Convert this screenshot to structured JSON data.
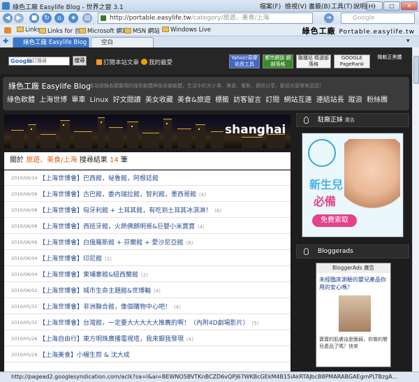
{
  "window": {
    "title": "綠色工廠 Easylife Blog - 世界之窗 3.1",
    "min": "–",
    "max": "□",
    "close": "✕"
  },
  "nav": {
    "url_host": "http://portable.easylife.tw",
    "url_path": "/category/旅遊、美食/上海",
    "search_placeholder": "Google"
  },
  "menus": [
    "檔案(F)",
    "檢視(V)",
    "書籤(B)",
    "工具(T)",
    "說明(H)"
  ],
  "bookmarks": [
    "Links",
    "Links for 台灣",
    "Microsoft 網站",
    "MSN 網站",
    "Windows Live"
  ],
  "brand": {
    "main": "綠色工廠",
    "sub": "Portable.easylife.tw"
  },
  "tabs": [
    {
      "label": "綠色工廠 Easylife Blog"
    },
    {
      "label": "空白"
    }
  ],
  "site": {
    "gsearch": "自訂搜尋",
    "gsearch_logo": "Google",
    "gbtn": "搜尋",
    "subscribe": "訂閱本站文章",
    "favorite": "我的最愛",
    "badges": [
      "Yahoo!奇摩 站長工具",
      "都市網誌 網部落格",
      "聯播站 精選部落格",
      "GOOGLE PageRank",
      "微軟正黑體"
    ],
    "title": "綠色工廠 Easylife Blog",
    "desc": "本站收錄各類實用的綠色軟體與免安裝軟體，生活中的大小事、美食、電影、資訊分享，歡迎大家常來逛逛！",
    "nav": "綠色軟體 上海世博 單車 Linux 好文閱讀 美女收藏 美食&旅遊 標籤 訪客留言 訂閱 網站互連 連結站長 蹤浪 粉絲團",
    "banner_city": "shanghai",
    "result": {
      "prefix": "關於",
      "tag1": "旅遊、美食/上海",
      "suffix": "搜尋結果",
      "count": "14",
      "unit": "筆"
    }
  },
  "posts": [
    {
      "date": "2010/06/14",
      "title": "【上海世博會】巴西館，祕魯館，阿根廷館",
      "count": ""
    },
    {
      "date": "2010/06/09",
      "title": "【上海世博會】古巴館，委內瑞拉館，智利館，墨西哥館",
      "count": "(4)"
    },
    {
      "date": "2010/06/08",
      "title": "【上海世博會】匈牙利館 + 土耳其館，有吃到土耳其冰淇淋！",
      "count": "(6)"
    },
    {
      "date": "2010/06/08",
      "title": "【上海世博會】西班牙館，火熱佛朗明哥&巨嬰小米寶寶",
      "count": "(4)"
    },
    {
      "date": "2010/06/06",
      "title": "【上海世博會】白俄羅斯館 + 芬蘭館 + 愛沙尼亞館",
      "count": "(8)"
    },
    {
      "date": "2010/06/04",
      "title": "【上海世博會】印尼館",
      "count": "(1)"
    },
    {
      "date": "2010/06/04",
      "title": "【上海世博會】柬埔寨館&紐西蘭館",
      "count": "(2)"
    },
    {
      "date": "2010/06/02",
      "title": "【上海世博會】城市生命主題館&世博軸",
      "count": "(4)"
    },
    {
      "date": "2010/05/31",
      "title": "【上海世博會】非洲聯合館，像個購物中心吧！",
      "count": "(4)"
    },
    {
      "date": "2010/05/31",
      "title": "【上海世博會】台灣館，一定要大大大大大推薦的啊！（內附4D劇場影片）",
      "count": "(5)"
    },
    {
      "date": "2010/05/26",
      "title": "【上海自由行】東方明珠廣播電視塔，我來銀我發現",
      "count": "(4)"
    },
    {
      "date": "2010/05/29",
      "title": "【上海美食】小楊生煎 & 沈大成",
      "count": ""
    }
  ],
  "sidebar": {
    "head1": "駐廠正妹",
    "head1_ad": "廣告",
    "head2": "Bloggerads",
    "ad1_line1": "新生兒",
    "ad1_line2": "必備",
    "ad1_btn": "免費索取",
    "ad2_head": "BloggerAds 廣告",
    "ad2_text": "未經臨床測驗的嬰兒產品你用的安心嗎？",
    "ad2_text2": "寶寶的肌膚這麼脆弱，你做的嬰兒產品了嗎？快來"
  },
  "status": "http://pagead2.googlesyndication.com/aclk?sa=l&ai=BEWNO5BVTKnBCZD6vQPj67WKBcGEkM4B15iAkRTAJbcB8PMARABGAEgmPLTBzgA..."
}
